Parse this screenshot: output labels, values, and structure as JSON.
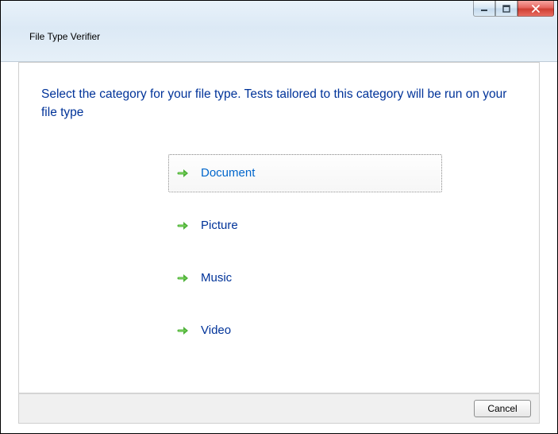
{
  "window": {
    "title": "File Type Verifier"
  },
  "heading": "Select the category for your file type.  Tests tailored to this category will be run on your file type",
  "options": [
    {
      "label": "Document",
      "focused": true
    },
    {
      "label": "Picture",
      "focused": false
    },
    {
      "label": "Music",
      "focused": false
    },
    {
      "label": "Video",
      "focused": false
    }
  ],
  "footer": {
    "cancel": "Cancel"
  },
  "icons": {
    "arrow": "arrow-right-icon",
    "minimize": "minimize-icon",
    "maximize": "maximize-icon",
    "close": "close-icon"
  }
}
